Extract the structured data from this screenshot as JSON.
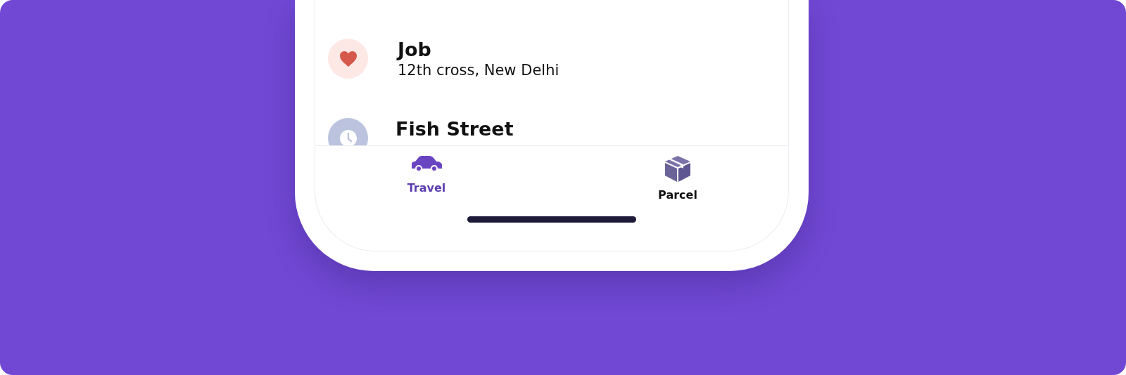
{
  "places": [
    {
      "kind": "favorite",
      "title": "Job",
      "subtitle": "12th cross, New Delhi"
    },
    {
      "kind": "recent",
      "title": "Fish Street"
    }
  ],
  "tabs": [
    {
      "kind": "car",
      "label": "Travel",
      "selected": true
    },
    {
      "kind": "box",
      "label": "Parcel",
      "selected": false
    }
  ]
}
